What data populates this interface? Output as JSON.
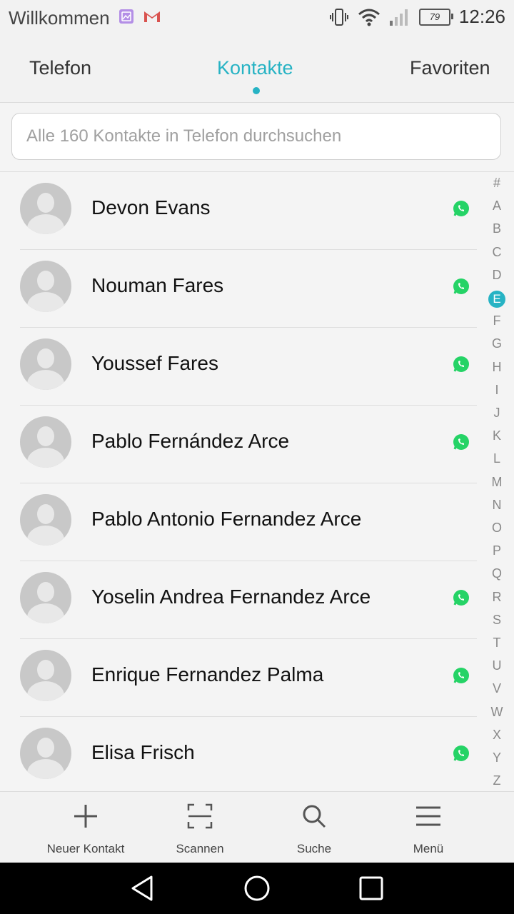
{
  "status_bar": {
    "title": "Willkommen",
    "time": "12:26",
    "battery": "79"
  },
  "tabs": [
    {
      "label": "Telefon"
    },
    {
      "label": "Kontakte"
    },
    {
      "label": "Favoriten"
    }
  ],
  "search": {
    "placeholder": "Alle 160 Kontakte in Telefon durchsuchen"
  },
  "contacts": [
    {
      "name": "Devon Evans",
      "whatsapp": true
    },
    {
      "name": "Nouman Fares",
      "whatsapp": true
    },
    {
      "name": "Youssef Fares",
      "whatsapp": true
    },
    {
      "name": "Pablo Fernández Arce",
      "whatsapp": true
    },
    {
      "name": "Pablo Antonio Fernandez Arce",
      "whatsapp": false
    },
    {
      "name": "Yoselin Andrea Fernandez Arce",
      "whatsapp": true
    },
    {
      "name": "Enrique Fernandez Palma",
      "whatsapp": true
    },
    {
      "name": "Elisa Frisch",
      "whatsapp": true
    }
  ],
  "index": [
    "#",
    "A",
    "B",
    "C",
    "D",
    "E",
    "F",
    "G",
    "H",
    "I",
    "J",
    "K",
    "L",
    "M",
    "N",
    "O",
    "P",
    "Q",
    "R",
    "S",
    "T",
    "U",
    "V",
    "W",
    "X",
    "Y",
    "Z"
  ],
  "index_active": "E",
  "toolbar": {
    "new_contact": "Neuer Kontakt",
    "scan": "Scannen",
    "search": "Suche",
    "menu": "Menü"
  },
  "colors": {
    "accent": "#27b3c4",
    "whatsapp": "#25d366"
  }
}
